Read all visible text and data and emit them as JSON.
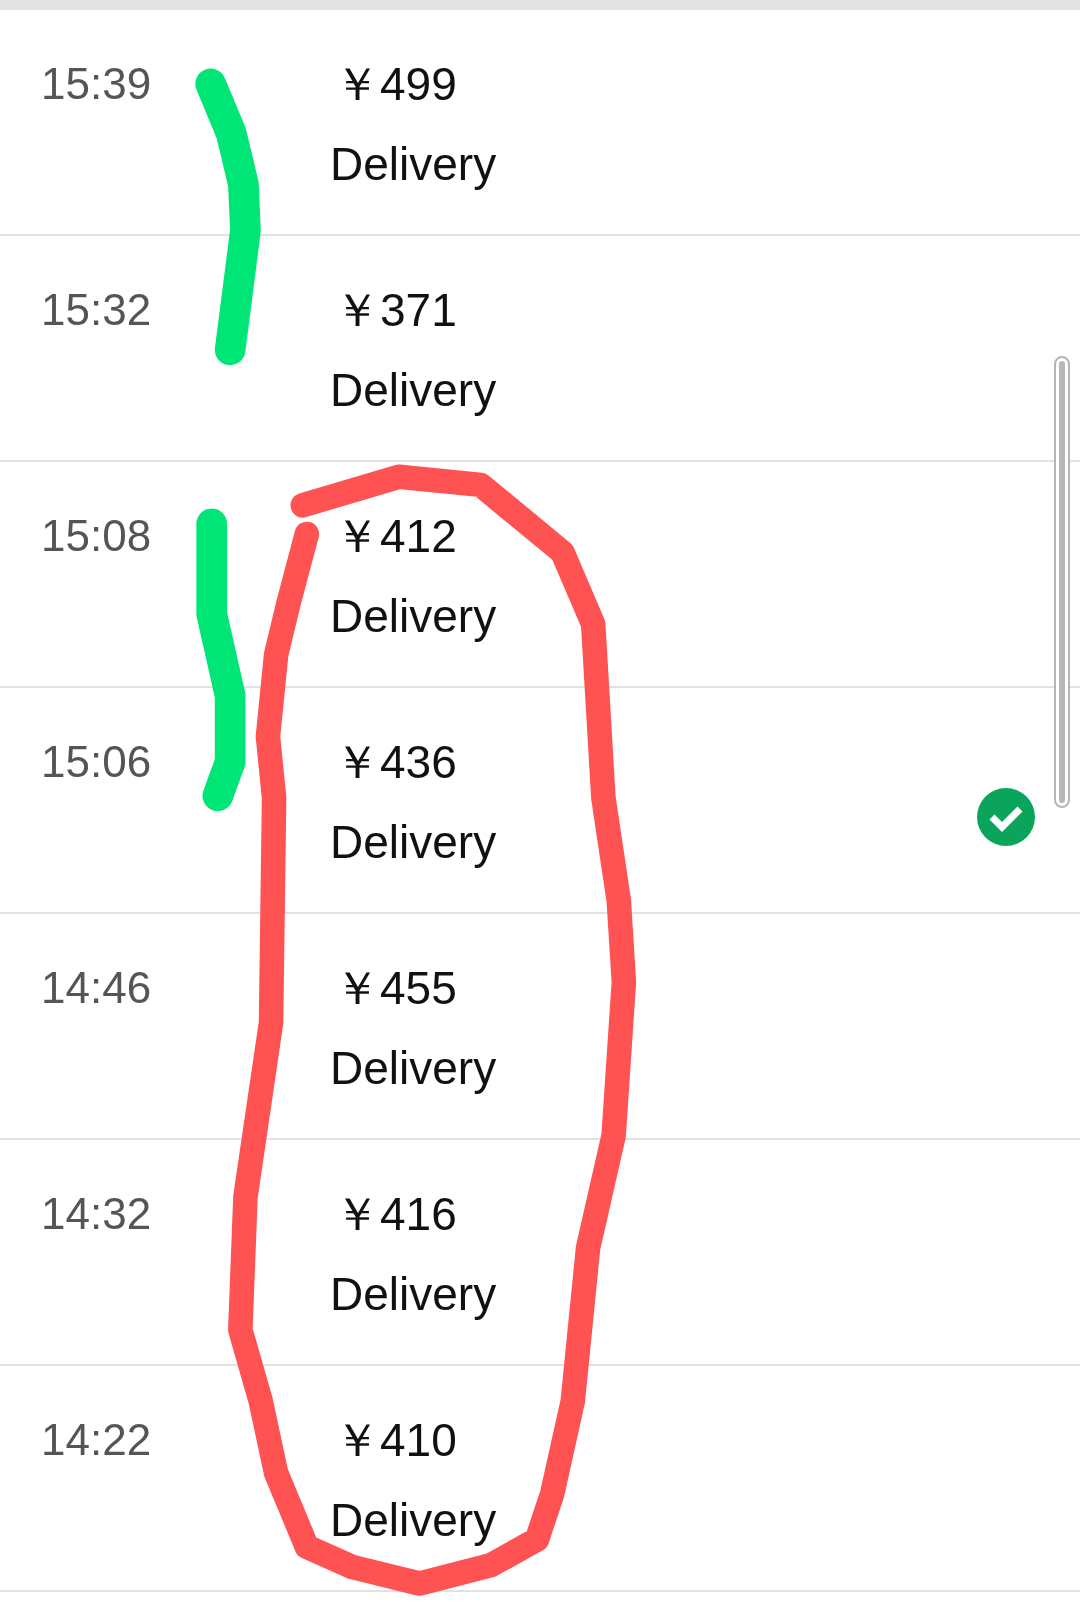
{
  "rows": [
    {
      "time": "15:39",
      "price": "￥499",
      "label": "Delivery",
      "checked": false
    },
    {
      "time": "15:32",
      "price": "￥371",
      "label": "Delivery",
      "checked": false
    },
    {
      "time": "15:08",
      "price": "￥412",
      "label": "Delivery",
      "checked": false
    },
    {
      "time": "15:06",
      "price": "￥436",
      "label": "Delivery",
      "checked": true
    },
    {
      "time": "14:46",
      "price": "￥455",
      "label": "Delivery",
      "checked": false
    },
    {
      "time": "14:32",
      "price": "￥416",
      "label": "Delivery",
      "checked": false
    },
    {
      "time": "14:22",
      "price": "￥410",
      "label": "Delivery",
      "checked": false
    }
  ]
}
